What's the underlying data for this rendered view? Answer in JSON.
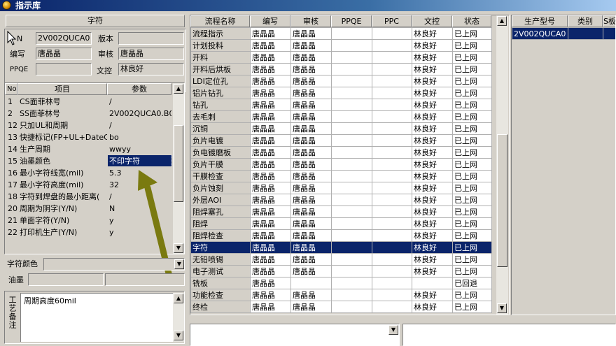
{
  "window": {
    "title": "指示库"
  },
  "left": {
    "group_title": "字符",
    "id_label": "N",
    "id_value": "2V002QUCA0",
    "version_label": "版本",
    "version_value": "",
    "editor_label": "编写",
    "editor_value": "唐晶晶",
    "reviewer_label": "审核",
    "reviewer_value": "唐晶晶",
    "ppqe_label": "PPQE",
    "ppqe_value": "",
    "doc_control_label": "文控",
    "doc_control_value": "林良好",
    "param_headers": [
      "No",
      "项目",
      "参数"
    ],
    "params": [
      {
        "no": "1",
        "item": "CS面菲林号",
        "value": "/"
      },
      {
        "no": "2",
        "item": "SS面菲林号",
        "value": "2V002QUCA0.B0"
      },
      {
        "no": "12",
        "item": "只加UL和周期",
        "value": "/"
      },
      {
        "no": "13",
        "item": "快捷标记(FP+UL+DateCo",
        "value": "bo"
      },
      {
        "no": "14",
        "item": "生产周期",
        "value": "wwyy"
      },
      {
        "no": "15",
        "item": "油墨颜色",
        "value": "不印字符"
      },
      {
        "no": "16",
        "item": "最小字符线宽(mil)",
        "value": "5.3"
      },
      {
        "no": "17",
        "item": "最小字符高度(mil)",
        "value": "32"
      },
      {
        "no": "18",
        "item": "字符到焊盘的最小距离(",
        "value": "/"
      },
      {
        "no": "20",
        "item": "周期为阴字(Y/N)",
        "value": "N"
      },
      {
        "no": "21",
        "item": "单面字符(Y/N)",
        "value": "y"
      },
      {
        "no": "22",
        "item": "打印机生产(Y/N)",
        "value": "y"
      }
    ],
    "char_color_label": "字符颜色",
    "char_color_value": "",
    "ink_label": "油墨",
    "ink_value_1": "",
    "ink_value_2": "",
    "remark_label": "工艺备注",
    "remark_value": "周期高度60mil"
  },
  "middle": {
    "headers": [
      "流程名称",
      "编写",
      "审核",
      "PPQE",
      "PPC",
      "文控",
      "状态"
    ],
    "rows": [
      {
        "name": "流程指示",
        "editor": "唐晶晶",
        "reviewer": "唐晶晶",
        "ppqe": "",
        "ppc": "",
        "doc": "林良好",
        "status": "已上网"
      },
      {
        "name": "计划投料",
        "editor": "唐晶晶",
        "reviewer": "唐晶晶",
        "ppqe": "",
        "ppc": "",
        "doc": "林良好",
        "status": "已上网"
      },
      {
        "name": "开料",
        "editor": "唐晶晶",
        "reviewer": "唐晶晶",
        "ppqe": "",
        "ppc": "",
        "doc": "林良好",
        "status": "已上网"
      },
      {
        "name": "开料后烘板",
        "editor": "唐晶晶",
        "reviewer": "唐晶晶",
        "ppqe": "",
        "ppc": "",
        "doc": "林良好",
        "status": "已上网"
      },
      {
        "name": "LDI定位孔",
        "editor": "唐晶晶",
        "reviewer": "唐晶晶",
        "ppqe": "",
        "ppc": "",
        "doc": "林良好",
        "status": "已上网"
      },
      {
        "name": "铝片钻孔",
        "editor": "唐晶晶",
        "reviewer": "唐晶晶",
        "ppqe": "",
        "ppc": "",
        "doc": "林良好",
        "status": "已上网"
      },
      {
        "name": "钻孔",
        "editor": "唐晶晶",
        "reviewer": "唐晶晶",
        "ppqe": "",
        "ppc": "",
        "doc": "林良好",
        "status": "已上网"
      },
      {
        "name": "去毛刺",
        "editor": "唐晶晶",
        "reviewer": "唐晶晶",
        "ppqe": "",
        "ppc": "",
        "doc": "林良好",
        "status": "已上网"
      },
      {
        "name": "沉铜",
        "editor": "唐晶晶",
        "reviewer": "唐晶晶",
        "ppqe": "",
        "ppc": "",
        "doc": "林良好",
        "status": "已上网"
      },
      {
        "name": "负片电镀",
        "editor": "唐晶晶",
        "reviewer": "唐晶晶",
        "ppqe": "",
        "ppc": "",
        "doc": "林良好",
        "status": "已上网"
      },
      {
        "name": "负电镀磨板",
        "editor": "唐晶晶",
        "reviewer": "唐晶晶",
        "ppqe": "",
        "ppc": "",
        "doc": "林良好",
        "status": "已上网"
      },
      {
        "name": "负片干膜",
        "editor": "唐晶晶",
        "reviewer": "唐晶晶",
        "ppqe": "",
        "ppc": "",
        "doc": "林良好",
        "status": "已上网"
      },
      {
        "name": "干膜检查",
        "editor": "唐晶晶",
        "reviewer": "唐晶晶",
        "ppqe": "",
        "ppc": "",
        "doc": "林良好",
        "status": "已上网"
      },
      {
        "name": "负片蚀刻",
        "editor": "唐晶晶",
        "reviewer": "唐晶晶",
        "ppqe": "",
        "ppc": "",
        "doc": "林良好",
        "status": "已上网"
      },
      {
        "name": "外层AOI",
        "editor": "唐晶晶",
        "reviewer": "唐晶晶",
        "ppqe": "",
        "ppc": "",
        "doc": "林良好",
        "status": "已上网"
      },
      {
        "name": "阻焊塞孔",
        "editor": "唐晶晶",
        "reviewer": "唐晶晶",
        "ppqe": "",
        "ppc": "",
        "doc": "林良好",
        "status": "已上网"
      },
      {
        "name": "阻焊",
        "editor": "唐晶晶",
        "reviewer": "唐晶晶",
        "ppqe": "",
        "ppc": "",
        "doc": "林良好",
        "status": "已上网"
      },
      {
        "name": "阻焊检查",
        "editor": "唐晶晶",
        "reviewer": "唐晶晶",
        "ppqe": "",
        "ppc": "",
        "doc": "林良好",
        "status": "已上网"
      },
      {
        "name": "字符",
        "editor": "唐晶晶",
        "reviewer": "唐晶晶",
        "ppqe": "",
        "ppc": "",
        "doc": "林良好",
        "status": "已上网"
      },
      {
        "name": "无铅喷锡",
        "editor": "唐晶晶",
        "reviewer": "唐晶晶",
        "ppqe": "",
        "ppc": "",
        "doc": "林良好",
        "status": "已上网"
      },
      {
        "name": "电子测试",
        "editor": "唐晶晶",
        "reviewer": "唐晶晶",
        "ppqe": "",
        "ppc": "",
        "doc": "林良好",
        "status": "已上网"
      },
      {
        "name": "铣板",
        "editor": "唐晶晶",
        "reviewer": "",
        "ppqe": "",
        "ppc": "",
        "doc": "",
        "status": "已回退"
      },
      {
        "name": "功能检查",
        "editor": "唐晶晶",
        "reviewer": "唐晶晶",
        "ppqe": "",
        "ppc": "",
        "doc": "林良好",
        "status": "已上网"
      },
      {
        "name": "终检",
        "editor": "唐晶晶",
        "reviewer": "唐晶晶",
        "ppqe": "",
        "ppc": "",
        "doc": "林良好",
        "status": "已上网"
      }
    ]
  },
  "right": {
    "headers": [
      "生产型号",
      "类别",
      "S板"
    ],
    "rows": [
      {
        "model": "2V002QUCA0",
        "category": "",
        "s": ""
      }
    ]
  }
}
